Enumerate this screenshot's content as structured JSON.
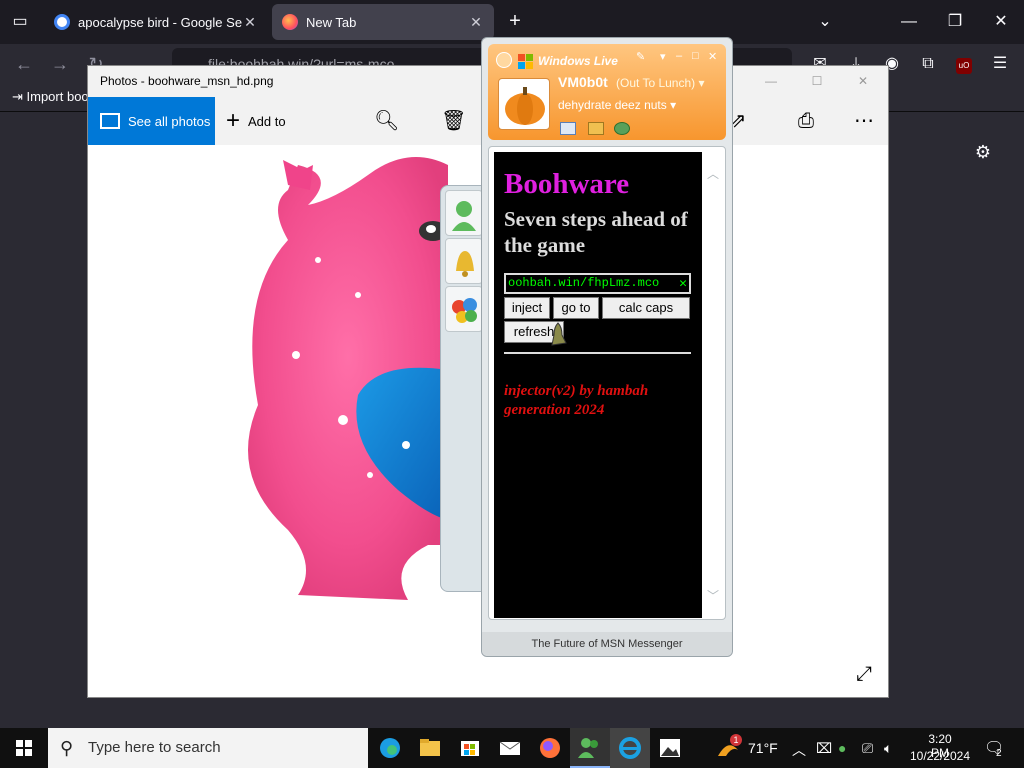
{
  "browser": {
    "tabs": [
      {
        "title": "apocalypse bird - Google Search",
        "close": "✕"
      },
      {
        "title": "New Tab",
        "close": "✕"
      }
    ],
    "new_tab": "+",
    "url": "file:boohbah.win/?url=ms-mco",
    "bookmark": "Import boo"
  },
  "photos": {
    "title": "Photos - boohware_msn_hd.png",
    "see_all": "See all photos",
    "add_to": "Add to"
  },
  "msn": {
    "brand": "Windows Live",
    "username": "VM0b0t",
    "status": "(Out To Lunch)",
    "personal_message": "dehydrate deez nuts",
    "footer": "The Future of MSN Messenger"
  },
  "boohware": {
    "title": "Boohware",
    "subtitle": "Seven steps ahead of the game",
    "url_value": "oohbah.win/fhpLmz.mco",
    "clear": "✕",
    "buttons": {
      "inject": "inject",
      "goto": "go to",
      "calc_caps": "calc caps",
      "refresh": "refresh"
    },
    "credit_line1": "injector(v2) by hambah",
    "credit_line2": "generation 2024"
  },
  "taskbar": {
    "search_placeholder": "Type here to search",
    "weather": "71°F",
    "weather_badge": "1",
    "time": "3:20 PM",
    "date": "10/22/2024",
    "notifications": "2"
  },
  "colors": {
    "accent_blue": "#0078d7",
    "msn_orange": "#f7962e",
    "boohware_magenta": "#e020e0",
    "credit_red": "#e01010",
    "url_green": "#00ff00"
  }
}
